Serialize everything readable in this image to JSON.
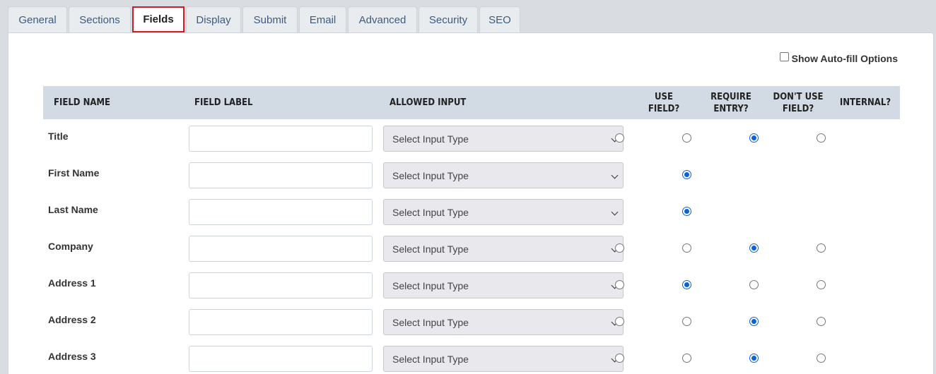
{
  "tabs": [
    {
      "label": "General",
      "active": false
    },
    {
      "label": "Sections",
      "active": false
    },
    {
      "label": "Fields",
      "active": true
    },
    {
      "label": "Display",
      "active": false
    },
    {
      "label": "Submit",
      "active": false
    },
    {
      "label": "Email",
      "active": false
    },
    {
      "label": "Advanced",
      "active": false
    },
    {
      "label": "Security",
      "active": false
    },
    {
      "label": "SEO",
      "active": false
    }
  ],
  "autofill": {
    "label": "Show Auto-fill Options",
    "checked": false
  },
  "columns": {
    "field_name": "FIELD NAME",
    "field_label": "FIELD LABEL",
    "allowed_input": "ALLOWED INPUT",
    "use_field_1": "USE",
    "use_field_2": "FIELD?",
    "require_1": "REQUIRE",
    "require_2": "ENTRY?",
    "dont_use_1": "DON'T USE",
    "dont_use_2": "FIELD?",
    "internal": "INTERNAL?"
  },
  "select_placeholder": "Select Input Type",
  "rows": [
    {
      "name": "Title",
      "label_value": "",
      "input_type": "Select Input Type",
      "options": [
        "use",
        "require",
        "dontuse",
        "internal"
      ],
      "selected": "dontuse"
    },
    {
      "name": "First Name",
      "label_value": "",
      "input_type": "Select Input Type",
      "options": [
        "require"
      ],
      "selected": "require"
    },
    {
      "name": "Last Name",
      "label_value": "",
      "input_type": "Select Input Type",
      "options": [
        "require"
      ],
      "selected": "require"
    },
    {
      "name": "Company",
      "label_value": "",
      "input_type": "Select Input Type",
      "options": [
        "use",
        "require",
        "dontuse",
        "internal"
      ],
      "selected": "dontuse"
    },
    {
      "name": "Address 1",
      "label_value": "",
      "input_type": "Select Input Type",
      "options": [
        "use",
        "require",
        "dontuse",
        "internal"
      ],
      "selected": "require"
    },
    {
      "name": "Address 2",
      "label_value": "",
      "input_type": "Select Input Type",
      "options": [
        "use",
        "require",
        "dontuse",
        "internal"
      ],
      "selected": "dontuse"
    },
    {
      "name": "Address 3",
      "label_value": "",
      "input_type": "Select Input Type",
      "options": [
        "use",
        "require",
        "dontuse",
        "internal"
      ],
      "selected": "dontuse"
    }
  ]
}
